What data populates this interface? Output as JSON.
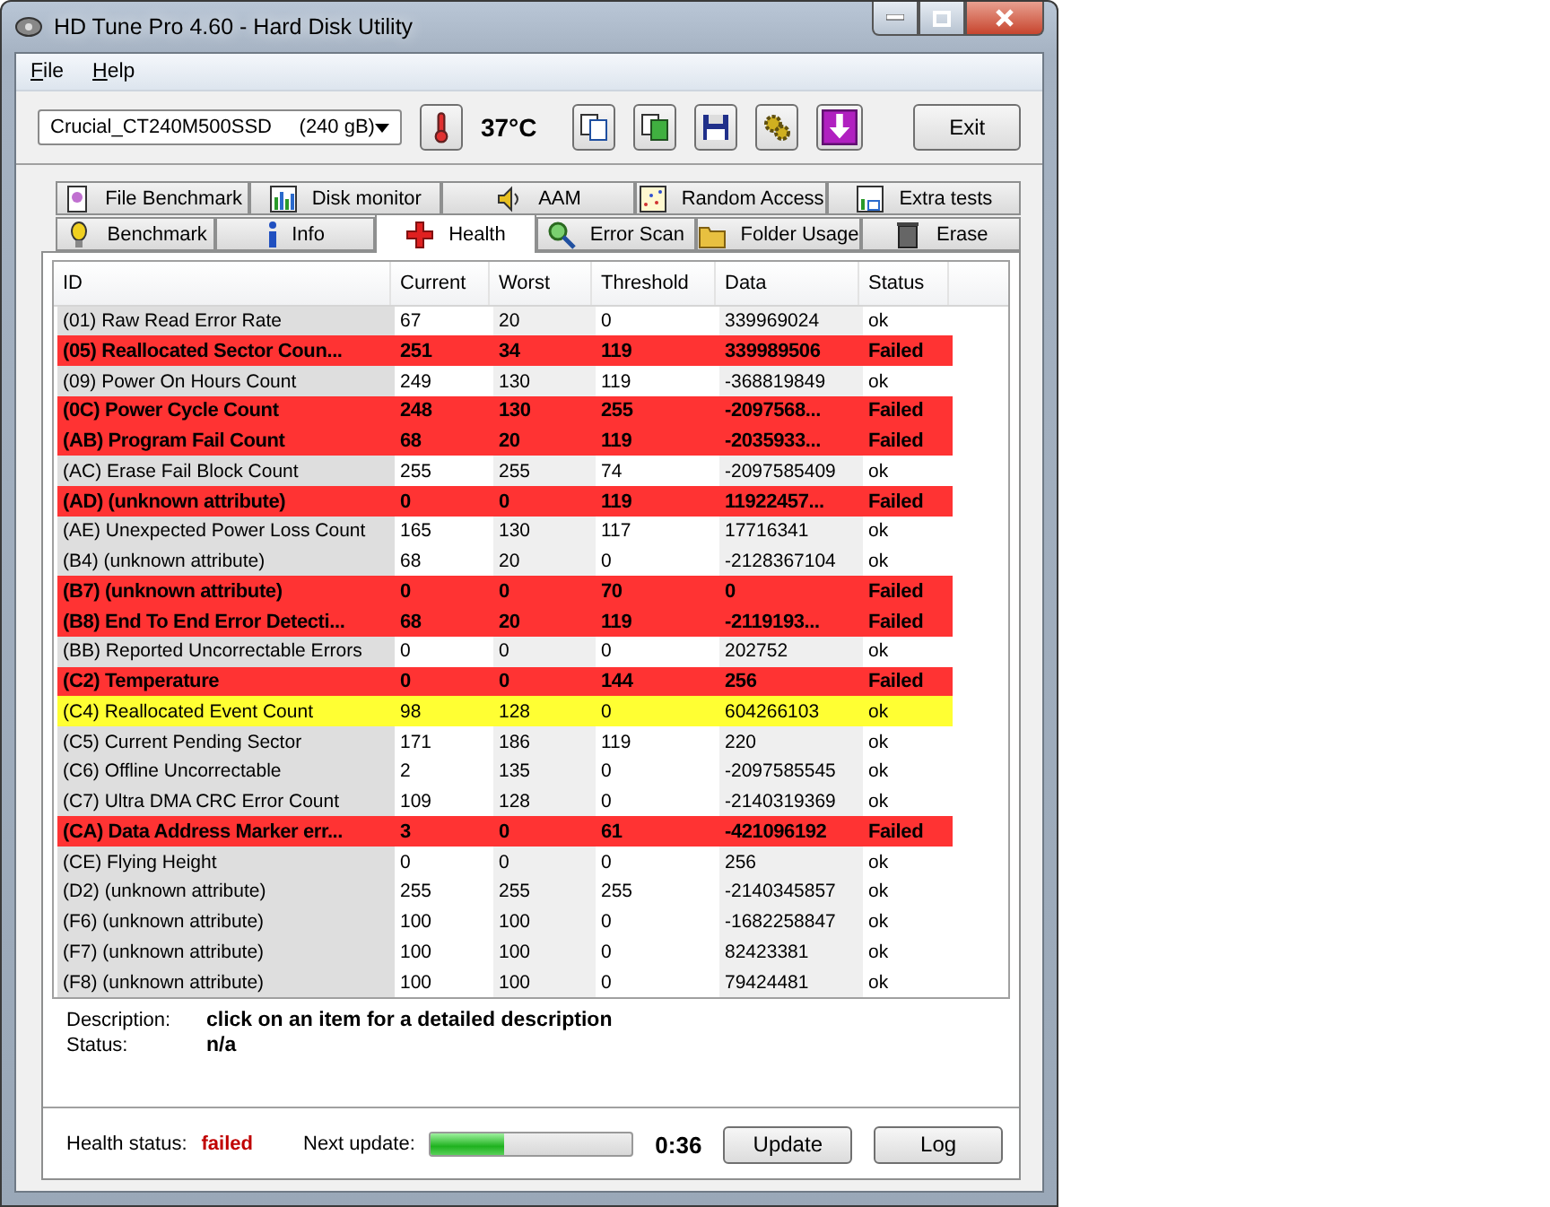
{
  "window": {
    "title": "HD Tune Pro 4.60 - Hard Disk Utility"
  },
  "menu": [
    {
      "label": "File"
    },
    {
      "label": "Help"
    }
  ],
  "toolbar": {
    "drive": "Crucial_CT240M500SSD     (240 gB)",
    "temperature": "37°C",
    "exit": "Exit"
  },
  "tabs_top": [
    {
      "label": "File Benchmark",
      "kind": "file",
      "selected": false
    },
    {
      "label": "Disk monitor",
      "kind": "monitor",
      "selected": false
    },
    {
      "label": "AAM",
      "kind": "speaker",
      "selected": false
    },
    {
      "label": "Random Access",
      "kind": "random",
      "selected": false
    },
    {
      "label": "Extra tests",
      "kind": "extra",
      "selected": false
    }
  ],
  "tabs_bottom": [
    {
      "label": "Benchmark",
      "kind": "bulb",
      "selected": false
    },
    {
      "label": "Info",
      "kind": "info",
      "selected": false
    },
    {
      "label": "Health",
      "kind": "cross",
      "selected": true
    },
    {
      "label": "Error Scan",
      "kind": "magnifier",
      "selected": false
    },
    {
      "label": "Folder Usage",
      "kind": "folder",
      "selected": false
    },
    {
      "label": "Erase",
      "kind": "trash",
      "selected": false
    }
  ],
  "table": {
    "columns": [
      "ID",
      "Current",
      "Worst",
      "Threshold",
      "Data",
      "Status"
    ],
    "rows": [
      {
        "id": "(01) Raw Read Error Rate",
        "current": "67",
        "worst": "20",
        "threshold": "0",
        "data": "339969024",
        "status": "ok",
        "kind": "ok"
      },
      {
        "id": "(05) Reallocated Sector Coun...",
        "current": "251",
        "worst": "34",
        "threshold": "119",
        "data": "339989506",
        "status": "Failed",
        "kind": "failed"
      },
      {
        "id": "(09) Power On Hours Count",
        "current": "249",
        "worst": "130",
        "threshold": "119",
        "data": "-368819849",
        "status": "ok",
        "kind": "ok"
      },
      {
        "id": "(0C) Power Cycle Count",
        "current": "248",
        "worst": "130",
        "threshold": "255",
        "data": "-2097568...",
        "status": "Failed",
        "kind": "failed"
      },
      {
        "id": "(AB) Program Fail Count",
        "current": "68",
        "worst": "20",
        "threshold": "119",
        "data": "-2035933...",
        "status": "Failed",
        "kind": "failed"
      },
      {
        "id": "(AC) Erase Fail Block Count",
        "current": "255",
        "worst": "255",
        "threshold": "74",
        "data": "-2097585409",
        "status": "ok",
        "kind": "ok"
      },
      {
        "id": "(AD) (unknown attribute)",
        "current": "0",
        "worst": "0",
        "threshold": "119",
        "data": "11922457...",
        "status": "Failed",
        "kind": "failed"
      },
      {
        "id": "(AE) Unexpected Power Loss Count",
        "current": "165",
        "worst": "130",
        "threshold": "117",
        "data": "17716341",
        "status": "ok",
        "kind": "ok"
      },
      {
        "id": "(B4) (unknown attribute)",
        "current": "68",
        "worst": "20",
        "threshold": "0",
        "data": "-2128367104",
        "status": "ok",
        "kind": "ok"
      },
      {
        "id": "(B7) (unknown attribute)",
        "current": "0",
        "worst": "0",
        "threshold": "70",
        "data": "0",
        "status": "Failed",
        "kind": "failed"
      },
      {
        "id": "(B8) End To End Error Detecti...",
        "current": "68",
        "worst": "20",
        "threshold": "119",
        "data": "-2119193...",
        "status": "Failed",
        "kind": "failed"
      },
      {
        "id": "(BB) Reported Uncorrectable Errors",
        "current": "0",
        "worst": "0",
        "threshold": "0",
        "data": "202752",
        "status": "ok",
        "kind": "ok"
      },
      {
        "id": "(C2) Temperature",
        "current": "0",
        "worst": "0",
        "threshold": "144",
        "data": "256",
        "status": "Failed",
        "kind": "failed"
      },
      {
        "id": "(C4) Reallocated Event Count",
        "current": "98",
        "worst": "128",
        "threshold": "0",
        "data": "604266103",
        "status": "ok",
        "kind": "warning"
      },
      {
        "id": "(C5) Current Pending Sector",
        "current": "171",
        "worst": "186",
        "threshold": "119",
        "data": "220",
        "status": "ok",
        "kind": "ok"
      },
      {
        "id": "(C6) Offline Uncorrectable",
        "current": "2",
        "worst": "135",
        "threshold": "0",
        "data": "-2097585545",
        "status": "ok",
        "kind": "ok"
      },
      {
        "id": "(C7) Ultra DMA CRC Error Count",
        "current": "109",
        "worst": "128",
        "threshold": "0",
        "data": "-2140319369",
        "status": "ok",
        "kind": "ok"
      },
      {
        "id": "(CA) Data Address Marker err...",
        "current": "3",
        "worst": "0",
        "threshold": "61",
        "data": "-421096192",
        "status": "Failed",
        "kind": "failed"
      },
      {
        "id": "(CE) Flying Height",
        "current": "0",
        "worst": "0",
        "threshold": "0",
        "data": "256",
        "status": "ok",
        "kind": "ok"
      },
      {
        "id": "(D2) (unknown attribute)",
        "current": "255",
        "worst": "255",
        "threshold": "255",
        "data": "-2140345857",
        "status": "ok",
        "kind": "ok"
      },
      {
        "id": "(F6) (unknown attribute)",
        "current": "100",
        "worst": "100",
        "threshold": "0",
        "data": "-1682258847",
        "status": "ok",
        "kind": "ok"
      },
      {
        "id": "(F7) (unknown attribute)",
        "current": "100",
        "worst": "100",
        "threshold": "0",
        "data": "82423381",
        "status": "ok",
        "kind": "ok"
      },
      {
        "id": "(F8) (unknown attribute)",
        "current": "100",
        "worst": "100",
        "threshold": "0",
        "data": "79424481",
        "status": "ok",
        "kind": "ok"
      }
    ]
  },
  "details": [
    {
      "label": "Description:",
      "value": "click on an item for a detailed description"
    },
    {
      "label": "Status:",
      "value": "n/a"
    }
  ],
  "footer": {
    "health_label": "Health status:",
    "health_value": "failed",
    "next_label": "Next update:",
    "level": 0.36,
    "countdown": "0:36",
    "buttons": [
      "Update",
      "Log"
    ]
  }
}
